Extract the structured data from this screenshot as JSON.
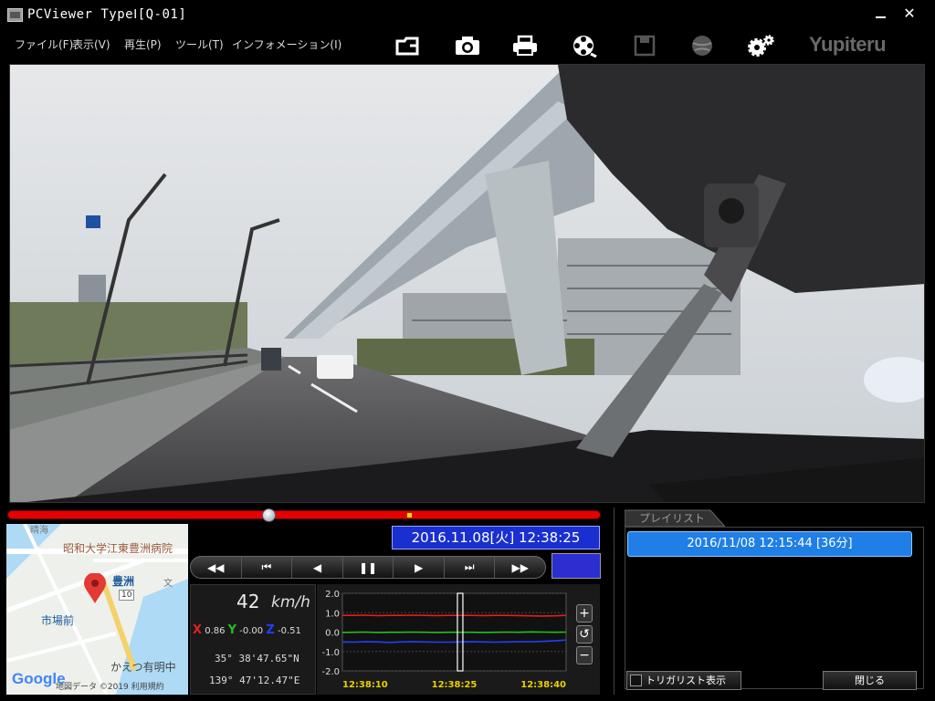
{
  "window": {
    "title": "PCViewer TypeⅠ[Q-01]",
    "minimize_glyph": "",
    "close_glyph": "✕"
  },
  "menu": {
    "items": [
      {
        "label": "ファイル(F)"
      },
      {
        "label": "表示(V)"
      },
      {
        "label": "再生(P)"
      },
      {
        "label": "ツール(T)"
      },
      {
        "label": "インフォメーション(I)"
      }
    ]
  },
  "toolbar": {
    "icons": [
      "folder-open-icon",
      "camera-icon",
      "print-icon",
      "film-reel-icon",
      "save-icon",
      "globe-icon",
      "settings-icon"
    ],
    "brand": "Yupiteru"
  },
  "player": {
    "datetime": "2016.11.08[火] 12:38:25",
    "speed_value": "42",
    "speed_unit": "km/h",
    "seek_progress": 0.44,
    "controls": [
      "◀◀",
      "⏮",
      "◀",
      "❚❚",
      "▶",
      "⏭",
      "▶▶"
    ],
    "color_swatch": "#2d2ed0"
  },
  "accel": {
    "x_label": "X",
    "x_value": "0.86",
    "y_label": "Y",
    "y_value": "-0.00",
    "z_label": "Z",
    "z_value": "-0.51",
    "x_color": "#e02020",
    "y_color": "#20c020",
    "z_color": "#2040ff"
  },
  "location": {
    "lat": "35° 38'47.65\"N",
    "lon": "139° 47'12.47\"E"
  },
  "map": {
    "labels": [
      "晴海",
      "昭和大学江東豊洲病院",
      "豊洲",
      "市場前",
      "かえつ有明中",
      "文",
      "10"
    ],
    "footer": "地図データ ©2019 利用規約",
    "google": "Google"
  },
  "chart_data": {
    "type": "line",
    "x_ticks": [
      "12:38:10",
      "12:38:25",
      "12:38:40"
    ],
    "y_ticks": [
      "2.0",
      "1.0",
      "0.0",
      "-1.0",
      "-2.0"
    ],
    "ylim": [
      -2.0,
      2.0
    ],
    "series": [
      {
        "name": "X",
        "color": "#e02020",
        "values": [
          0.86,
          0.86,
          0.87,
          0.85,
          0.86,
          0.86,
          0.87,
          0.86,
          0.85,
          0.86,
          0.86,
          0.86,
          0.85,
          0.86,
          0.86,
          0.85,
          0.84,
          0.83,
          0.84,
          0.86
        ]
      },
      {
        "name": "Y",
        "color": "#20c020",
        "values": [
          -0.02,
          -0.01,
          0.0,
          -0.02,
          -0.01,
          -0.01,
          0.0,
          -0.01,
          -0.02,
          -0.01,
          -0.01,
          -0.01,
          -0.02,
          -0.01,
          0.0,
          -0.01,
          0.01,
          0.0,
          -0.01,
          0.0
        ]
      },
      {
        "name": "Z",
        "color": "#2040ff",
        "values": [
          -0.51,
          -0.52,
          -0.5,
          -0.51,
          -0.53,
          -0.51,
          -0.5,
          -0.51,
          -0.52,
          -0.52,
          -0.51,
          -0.5,
          -0.51,
          -0.52,
          -0.51,
          -0.5,
          -0.5,
          -0.48,
          -0.45,
          -0.41
        ]
      }
    ],
    "cursor_index": 10,
    "zoom_buttons": [
      "+",
      "↺",
      "−"
    ]
  },
  "playlist": {
    "tab_label": "プレイリスト",
    "entries": [
      {
        "label": "2016/11/08 12:15:44 [36分]"
      }
    ],
    "trigger_label": "トリガリスト表示",
    "close_label": "閉じる"
  }
}
